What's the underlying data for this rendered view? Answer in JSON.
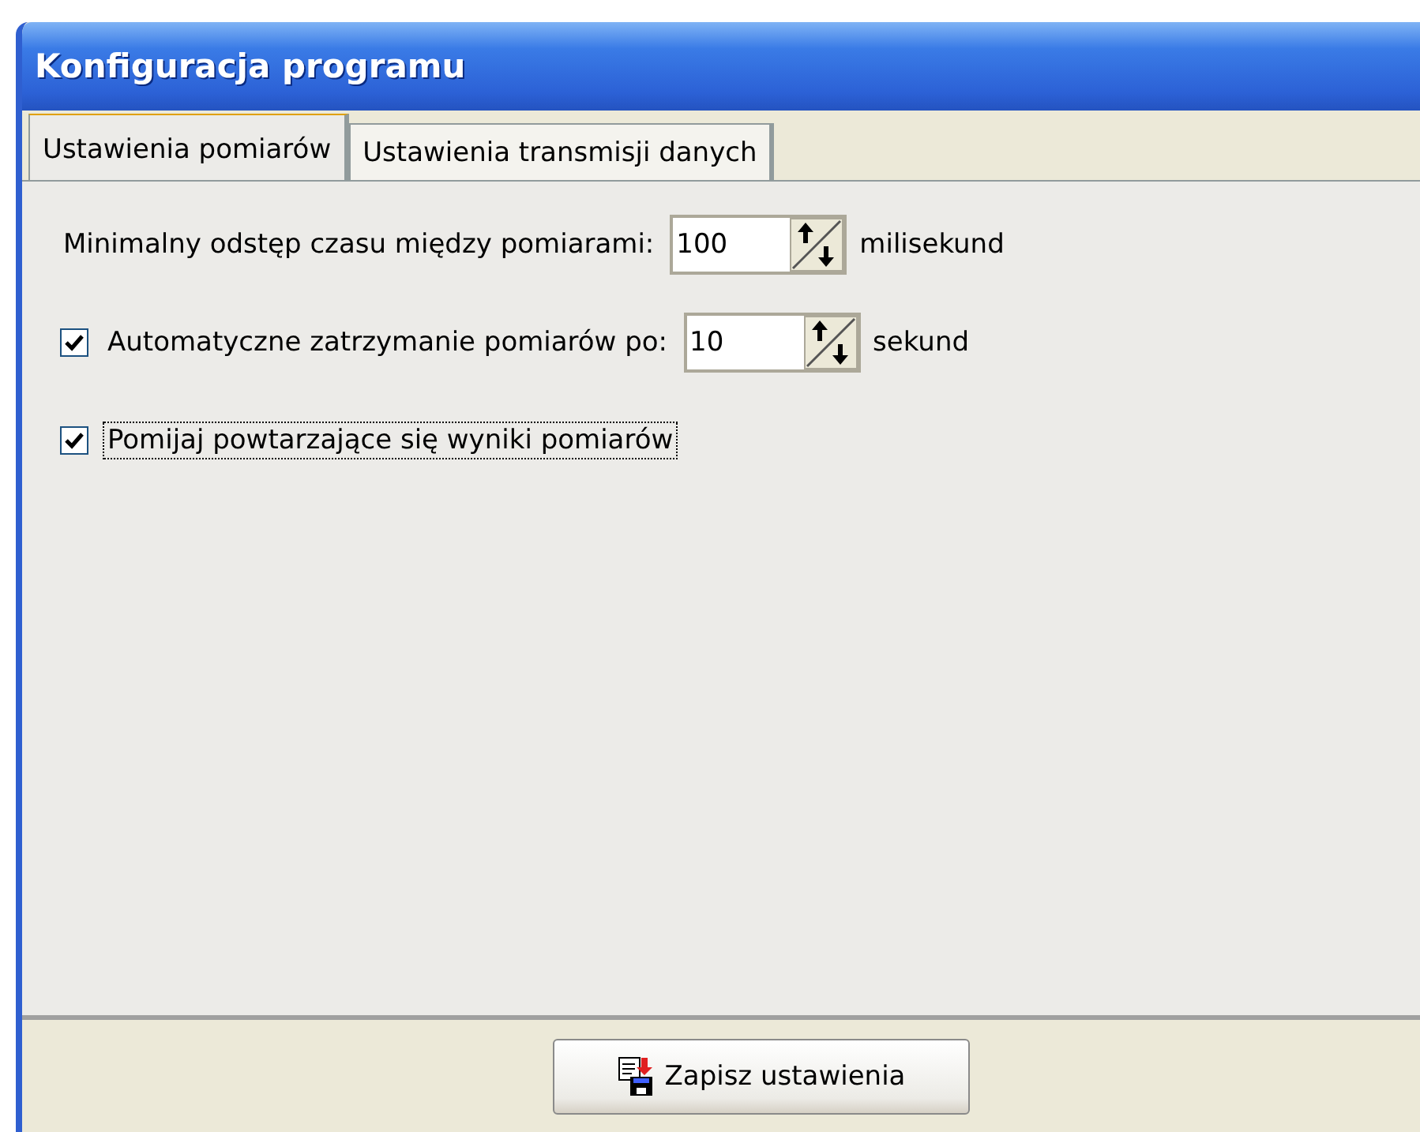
{
  "window": {
    "title": "Konfiguracja programu"
  },
  "tabs": [
    {
      "label": "Ustawienia pomiarów",
      "selected": true
    },
    {
      "label": "Ustawienia transmisji danych",
      "selected": false
    }
  ],
  "settings": [
    {
      "kind": "spinner",
      "label": "Minimalny odstęp czasu między pomiarami:",
      "value": "100",
      "unit": "milisekund"
    },
    {
      "kind": "checkbox-spinner",
      "label": "Automatyczne zatrzymanie pomiarów po:",
      "checked": true,
      "value": "10",
      "unit": "sekund"
    },
    {
      "kind": "checkbox",
      "label": "Pomijaj powtarzające się wyniki pomiarów",
      "checked": true,
      "focused": true
    }
  ],
  "buttons": [
    {
      "label": "Zapisz ustawienia"
    }
  ]
}
